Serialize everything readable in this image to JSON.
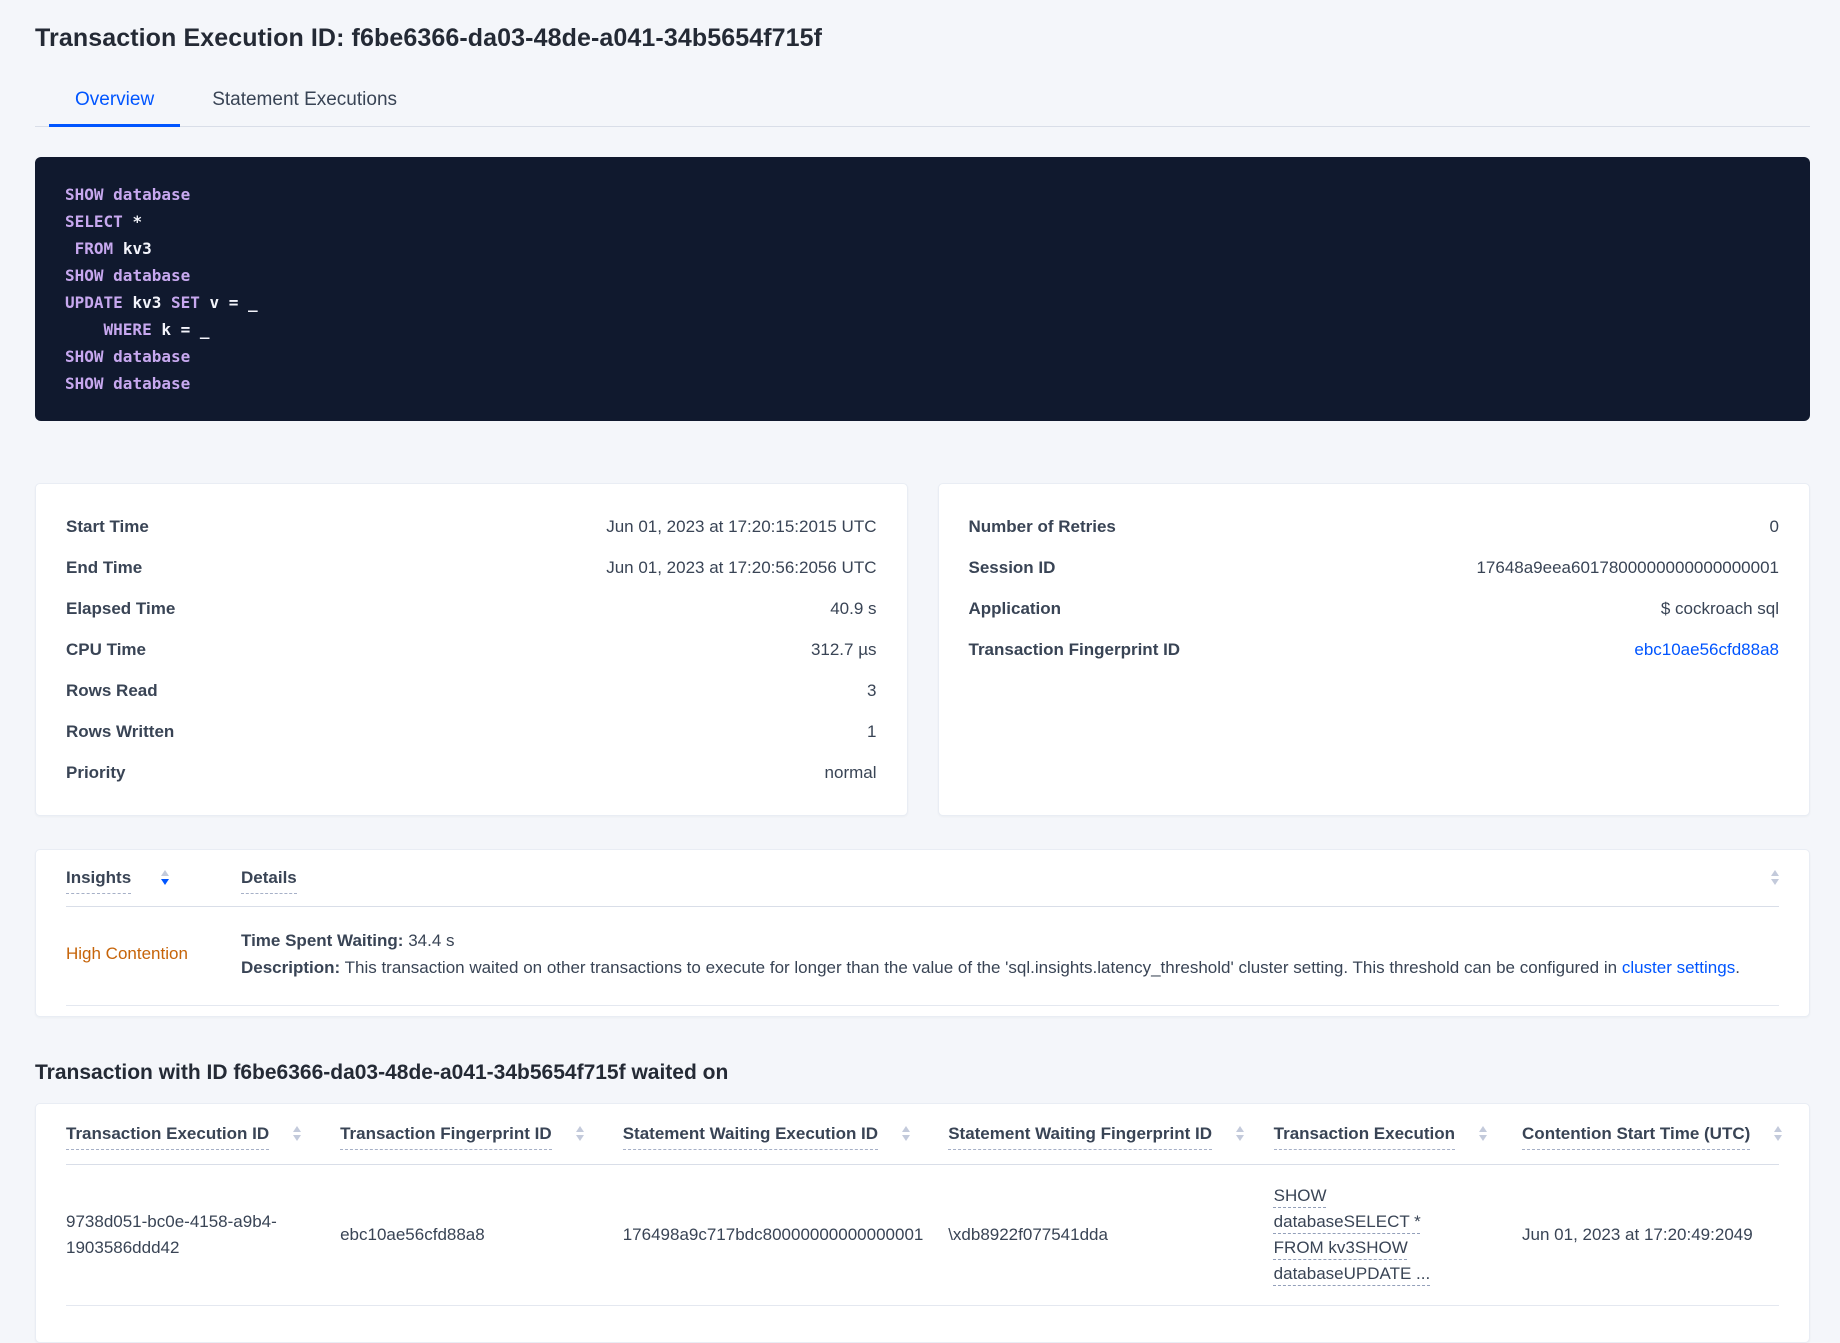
{
  "title": "Transaction Execution ID: f6be6366-da03-48de-a041-34b5654f715f",
  "tabs": {
    "overview": "Overview",
    "statement_executions": "Statement Executions"
  },
  "sql": {
    "lines": [
      [
        {
          "t": "SHOW ",
          "c": "kw"
        },
        {
          "t": "database",
          "c": "kw"
        }
      ],
      [
        {
          "t": "SELECT ",
          "c": "kw"
        },
        {
          "t": "*",
          "c": "pl"
        }
      ],
      [
        {
          "t": " ",
          "c": "pl"
        },
        {
          "t": "FROM ",
          "c": "kw"
        },
        {
          "t": "kv3",
          "c": "pl"
        }
      ],
      [
        {
          "t": "SHOW ",
          "c": "kw"
        },
        {
          "t": "database",
          "c": "kw"
        }
      ],
      [
        {
          "t": "UPDATE ",
          "c": "kw"
        },
        {
          "t": "kv3 ",
          "c": "pl"
        },
        {
          "t": "SET ",
          "c": "kw"
        },
        {
          "t": "v = _",
          "c": "pl"
        }
      ],
      [
        {
          "t": "    ",
          "c": "pl"
        },
        {
          "t": "WHERE ",
          "c": "kw"
        },
        {
          "t": "k = _",
          "c": "pl"
        }
      ],
      [
        {
          "t": "SHOW ",
          "c": "kw"
        },
        {
          "t": "database",
          "c": "kw"
        }
      ],
      [
        {
          "t": "SHOW ",
          "c": "kw"
        },
        {
          "t": "database",
          "c": "kw"
        }
      ]
    ]
  },
  "summary_left": {
    "rows": [
      {
        "label": "Start Time",
        "value": "Jun 01, 2023 at 17:20:15:2015 UTC",
        "link": false
      },
      {
        "label": "End Time",
        "value": "Jun 01, 2023 at 17:20:56:2056 UTC",
        "link": false
      },
      {
        "label": "Elapsed Time",
        "value": "40.9 s",
        "link": false
      },
      {
        "label": "CPU Time",
        "value": "312.7 µs",
        "link": false
      },
      {
        "label": "Rows Read",
        "value": "3",
        "link": false
      },
      {
        "label": "Rows Written",
        "value": "1",
        "link": false
      },
      {
        "label": "Priority",
        "value": "normal",
        "link": false
      }
    ]
  },
  "summary_right": {
    "rows": [
      {
        "label": "Number of Retries",
        "value": "0",
        "link": false
      },
      {
        "label": "Session ID",
        "value": "17648a9eea6017800000000000000001",
        "link": false
      },
      {
        "label": "Application",
        "value": "$ cockroach sql",
        "link": false
      },
      {
        "label": "Transaction Fingerprint ID",
        "value": "ebc10ae56cfd88a8",
        "link": true
      }
    ]
  },
  "insights": {
    "insights_label": "Insights",
    "details_label": "Details",
    "row": {
      "insight": "High Contention",
      "waiting_label": "Time Spent Waiting:",
      "waiting_value": "34.4 s",
      "description_label": "Description:",
      "description_text": "This transaction waited on other transactions to execute for longer than the value of the 'sql.insights.latency_threshold' cluster setting. This threshold can be configured in ",
      "description_link": "cluster settings",
      "description_end": "."
    }
  },
  "waited_on": {
    "heading": "Transaction with ID f6be6366-da03-48de-a041-34b5654f715f waited on",
    "columns": [
      "Transaction Execution ID",
      "Transaction Fingerprint ID",
      "Statement Waiting Execution ID",
      "Statement Waiting Fingerprint ID",
      "Transaction Execution",
      "Contention Start Time (UTC)"
    ],
    "row": {
      "transaction_execution_id": "9738d051-bc0e-4158-a9b4-1903586ddd42",
      "transaction_fingerprint_id": "ebc10ae56cfd88a8",
      "statement_waiting_execution_id": "176498a9c717bdc80000000000000001",
      "statement_waiting_fingerprint_id": "\\xdb8922f077541dda",
      "transaction_execution": "SHOW databaseSELECT * FROM kv3SHOW databaseUPDATE ...",
      "contention_start_time": "Jun 01, 2023 at 17:20:49:2049"
    }
  },
  "colors": {
    "accent_blue": "#0055ff",
    "insight_warning_orange": "#c66409",
    "code_background": "#10192e",
    "code_keyword": "#c7a8ef",
    "code_plain": "#f3f4fb",
    "page_background": "#f4f6fa"
  }
}
